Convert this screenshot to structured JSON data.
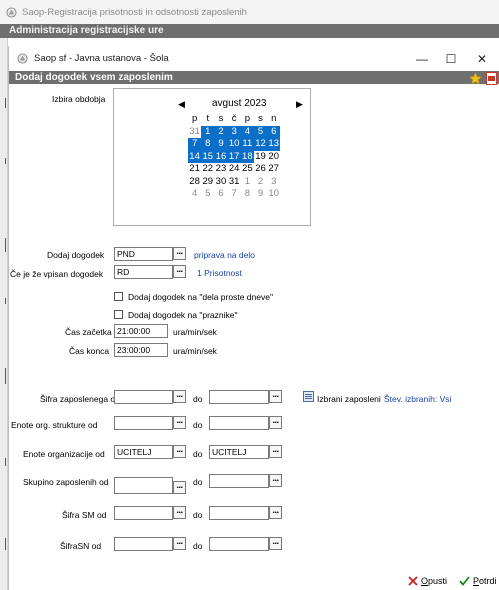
{
  "outer_window": {
    "title": "Saop-Registracija prisotnosti in odsotnosti zaposlenih"
  },
  "background_header": {
    "title": "Administracija registracijske ure"
  },
  "window": {
    "title": "Saop sf - Javna ustanova - Šola",
    "minimize": "—",
    "maximize": "☐",
    "close": "✕"
  },
  "dialog": {
    "title": "Dodaj dogodek vsem zaposlenim"
  },
  "calendar": {
    "label": "Izbira obdobja",
    "month_label": "avgust 2023",
    "prev": "◀",
    "next": "▶",
    "day_headers": [
      "p",
      "t",
      "s",
      "č",
      "p",
      "s",
      "n"
    ],
    "weeks": [
      [
        {
          "d": "31",
          "s": "other"
        },
        {
          "d": "1",
          "s": "sel"
        },
        {
          "d": "2",
          "s": "sel"
        },
        {
          "d": "3",
          "s": "sel"
        },
        {
          "d": "4",
          "s": "sel"
        },
        {
          "d": "5",
          "s": "sel"
        },
        {
          "d": "6",
          "s": "sel"
        }
      ],
      [
        {
          "d": "7",
          "s": "sel"
        },
        {
          "d": "8",
          "s": "sel"
        },
        {
          "d": "9",
          "s": "sel"
        },
        {
          "d": "10",
          "s": "sel"
        },
        {
          "d": "11",
          "s": "sel"
        },
        {
          "d": "12",
          "s": "sel"
        },
        {
          "d": "13",
          "s": "sel"
        }
      ],
      [
        {
          "d": "14",
          "s": "sel"
        },
        {
          "d": "15",
          "s": "sel"
        },
        {
          "d": "16",
          "s": "sel"
        },
        {
          "d": "17",
          "s": "sel"
        },
        {
          "d": "18",
          "s": "sel"
        },
        {
          "d": "19",
          "s": ""
        },
        {
          "d": "20",
          "s": ""
        }
      ],
      [
        {
          "d": "21",
          "s": ""
        },
        {
          "d": "22",
          "s": ""
        },
        {
          "d": "23",
          "s": ""
        },
        {
          "d": "24",
          "s": ""
        },
        {
          "d": "25",
          "s": ""
        },
        {
          "d": "26",
          "s": ""
        },
        {
          "d": "27",
          "s": ""
        }
      ],
      [
        {
          "d": "28",
          "s": ""
        },
        {
          "d": "29",
          "s": ""
        },
        {
          "d": "30",
          "s": ""
        },
        {
          "d": "31",
          "s": ""
        },
        {
          "d": "1",
          "s": "other"
        },
        {
          "d": "2",
          "s": "other"
        },
        {
          "d": "3",
          "s": "other"
        }
      ],
      [
        {
          "d": "4",
          "s": "other"
        },
        {
          "d": "5",
          "s": "other"
        },
        {
          "d": "6",
          "s": "other"
        },
        {
          "d": "7",
          "s": "other"
        },
        {
          "d": "8",
          "s": "other"
        },
        {
          "d": "9",
          "s": "other"
        },
        {
          "d": "10",
          "s": "other"
        }
      ]
    ]
  },
  "form": {
    "dodaj_dogodek": {
      "label": "Dodaj dogodek",
      "value": "PND",
      "desc": "priprava na delo"
    },
    "ce_je_vpisan": {
      "label": "Če je že vpisan dogodek",
      "value": "RD",
      "desc": "1 Prisotnost"
    },
    "chk_proste_dneve": {
      "label": "Dodaj dogodek na \"dela proste dneve\""
    },
    "chk_praznike": {
      "label": "Dodaj dogodek na \"praznike\""
    },
    "cas_zacetka": {
      "label": "Čas začetka",
      "value": "21:00:00",
      "unit": "ura/min/sek"
    },
    "cas_konca": {
      "label": "Čas konca",
      "value": "23:00:00",
      "unit": "ura/min/sek"
    },
    "do_label": "do",
    "dots": "...",
    "sifra_zaposlenega": {
      "label": "Šifra zaposlenega od",
      "from": "",
      "to": ""
    },
    "izbrani_zaposleni": {
      "label": "Izbrani zaposleni",
      "count_label": "Štev. izbranih: Vsi"
    },
    "enote_org_strukture": {
      "label": "Enote org. strukture od",
      "from": "",
      "to": ""
    },
    "enote_organizacije": {
      "label": "Enote organizacije od",
      "from": "UCITELJ",
      "to": "UCITELJ"
    },
    "skupino_zaposlenih": {
      "label": "Skupino zaposlenih od",
      "from": "",
      "to": ""
    },
    "sifra_sm": {
      "label": "Šifra SM od",
      "from": "",
      "to": ""
    },
    "sifra_sn": {
      "label": "ŠifraSN od",
      "from": "",
      "to": ""
    }
  },
  "buttons": {
    "opusti": {
      "accel": "O",
      "rest": "pusti",
      "icon": "close-x-icon",
      "color": "#cc1f1f"
    },
    "potrdi": {
      "accel": "P",
      "rest": "otrdi",
      "icon": "check-icon",
      "color": "#1a8a1a"
    }
  },
  "colors": {
    "header_bg": "#6f6f6f",
    "selection": "#0b6fc9",
    "link": "#1b3fa8"
  }
}
